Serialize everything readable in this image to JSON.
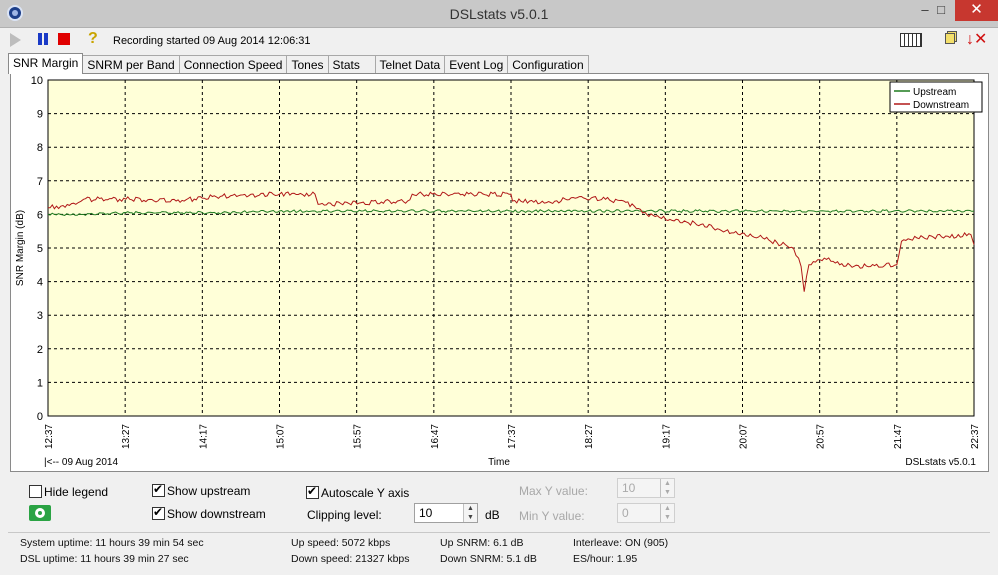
{
  "window": {
    "title": "DSLstats v5.0.1",
    "minimize": "‒",
    "maximize": "□",
    "close": "✕"
  },
  "toolbar": {
    "recording_text": "Recording started 09 Aug 2014 12:06:31"
  },
  "tabs": [
    {
      "label": "SNR Margin",
      "active": true
    },
    {
      "label": "SNRM per Band"
    },
    {
      "label": "Connection Speed"
    },
    {
      "label": "Tones"
    },
    {
      "label": "Stats"
    },
    {
      "label": "Telnet Data"
    },
    {
      "label": "Event Log"
    },
    {
      "label": "Configuration"
    }
  ],
  "chart_data": {
    "type": "line",
    "ylabel": "SNR Margin (dB)",
    "xlabel": "Time",
    "date_label": "|<-- 09 Aug 2014",
    "footer_label": "DSLstats v5.0.1",
    "ylim": [
      0,
      10
    ],
    "yticks": [
      0,
      1,
      2,
      3,
      4,
      5,
      6,
      7,
      8,
      9,
      10
    ],
    "xticks": [
      "12:37",
      "13:27",
      "14:17",
      "15:07",
      "15:57",
      "16:47",
      "17:37",
      "18:27",
      "19:17",
      "20:07",
      "20:57",
      "21:47",
      "22:37"
    ],
    "grid": true,
    "background": "#ffffd8",
    "legend_position": "top-right",
    "series": [
      {
        "name": "Upstream",
        "color": "#1e7a1e",
        "points": [
          [
            "12:37",
            6.0
          ],
          [
            "13:00",
            6.0
          ],
          [
            "13:30",
            6.05
          ],
          [
            "14:00",
            6.05
          ],
          [
            "14:30",
            6.05
          ],
          [
            "15:07",
            6.1
          ],
          [
            "15:30",
            6.1
          ],
          [
            "16:00",
            6.1
          ],
          [
            "16:30",
            6.1
          ],
          [
            "17:00",
            6.1
          ],
          [
            "17:37",
            6.1
          ],
          [
            "18:00",
            6.1
          ],
          [
            "18:27",
            6.1
          ],
          [
            "19:00",
            6.1
          ],
          [
            "19:30",
            6.1
          ],
          [
            "20:00",
            6.1
          ],
          [
            "20:30",
            6.1
          ],
          [
            "21:00",
            6.1
          ],
          [
            "21:30",
            6.1
          ],
          [
            "22:00",
            6.1
          ],
          [
            "22:37",
            6.1
          ]
        ]
      },
      {
        "name": "Downstream",
        "color": "#b01818",
        "points": [
          [
            "12:37",
            6.2
          ],
          [
            "12:55",
            6.3
          ],
          [
            "13:00",
            6.45
          ],
          [
            "13:30",
            6.45
          ],
          [
            "14:00",
            6.4
          ],
          [
            "14:30",
            6.55
          ],
          [
            "15:07",
            6.6
          ],
          [
            "15:30",
            6.6
          ],
          [
            "15:32",
            6.3
          ],
          [
            "16:00",
            6.35
          ],
          [
            "16:30",
            6.4
          ],
          [
            "16:33",
            6.6
          ],
          [
            "17:37",
            6.6
          ],
          [
            "17:38",
            6.4
          ],
          [
            "18:00",
            6.35
          ],
          [
            "18:20",
            6.5
          ],
          [
            "18:50",
            6.4
          ],
          [
            "19:05",
            6.0
          ],
          [
            "19:20",
            5.85
          ],
          [
            "19:40",
            5.7
          ],
          [
            "20:00",
            5.45
          ],
          [
            "20:20",
            5.3
          ],
          [
            "20:40",
            5.0
          ],
          [
            "20:45",
            4.45
          ],
          [
            "20:47",
            3.7
          ],
          [
            "20:50",
            4.5
          ],
          [
            "21:00",
            4.7
          ],
          [
            "21:10",
            4.5
          ],
          [
            "21:30",
            4.45
          ],
          [
            "21:47",
            4.5
          ],
          [
            "21:50",
            5.2
          ],
          [
            "22:00",
            5.3
          ],
          [
            "22:20",
            5.35
          ],
          [
            "22:35",
            5.4
          ],
          [
            "22:37",
            5.1
          ]
        ]
      }
    ]
  },
  "controls": {
    "hide_legend": "Hide legend",
    "show_upstream": "Show upstream",
    "show_downstream": "Show downstream",
    "autoscale": "Autoscale Y axis",
    "clipping_label": "Clipping level:",
    "clipping_value": "10",
    "clipping_unit": "dB",
    "max_y_label": "Max Y value:",
    "max_y_value": "10",
    "min_y_label": "Min Y value:",
    "min_y_value": "0"
  },
  "status": {
    "system_uptime": "System uptime:  11 hours 39 min 54 sec",
    "dsl_uptime": "DSL uptime: 11 hours 39 min 27 sec",
    "up_speed": "Up speed: 5072 kbps",
    "down_speed": "Down speed: 21327 kbps",
    "up_snrm": "Up SNRM: 6.1 dB",
    "down_snrm": "Down SNRM: 5.1 dB",
    "interleave": "Interleave: ON (905)",
    "es_hour": "ES/hour: 1.95"
  }
}
